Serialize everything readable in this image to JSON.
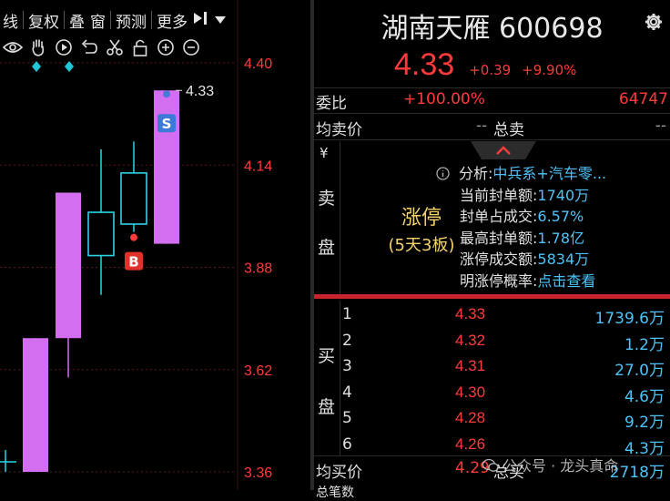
{
  "toolbar": {
    "items": [
      "线",
      "复权",
      "叠",
      "窗",
      "预测",
      "更多"
    ],
    "end_icon": "skip-to-end-icon",
    "dropdown_icon": "caret-down-icon"
  },
  "tools": [
    "eye-icon",
    "hand-icon",
    "replay-icon",
    "undo-icon",
    "scissors-icon",
    "lock-icon",
    "zoom-in-icon",
    "zoom-out-icon"
  ],
  "chart_data": {
    "type": "candlestick",
    "y_ticks": [
      "4.40",
      "4.14",
      "3.88",
      "3.62",
      "3.36"
    ],
    "ylim": [
      3.36,
      4.4
    ],
    "last_label": "4.33",
    "buy_marker": "B",
    "sell_marker": "S",
    "candles": [
      {
        "open": 3.36,
        "close": 3.7,
        "high": 3.7,
        "low": 3.36,
        "style": "limit-up"
      },
      {
        "open": 3.7,
        "close": 4.07,
        "high": 4.07,
        "low": 3.6,
        "style": "limit-up"
      },
      {
        "open": 3.91,
        "close": 4.02,
        "high": 4.18,
        "low": 3.81,
        "style": "hollow"
      },
      {
        "open": 3.99,
        "close": 4.12,
        "high": 4.2,
        "low": 3.97,
        "style": "hollow"
      },
      {
        "open": 3.94,
        "close": 4.33,
        "high": 4.33,
        "low": 3.94,
        "style": "limit-up"
      }
    ],
    "colors": {
      "limit_up": "#d46ef0",
      "hollow": "#2ad4e6",
      "axis": "#ff3b3b"
    }
  },
  "quote": {
    "name_code": "湖南天雁 600698",
    "price": "4.33",
    "change": "+0.39",
    "change_pct": "+9.90%",
    "wei_bi_label": "委比",
    "wei_bi": "+100.00%",
    "wei_cha": "64747",
    "avg_sell_label": "均卖价",
    "avg_sell": "--",
    "total_sell_label": "总卖",
    "total_sell": "--",
    "sell_side_label": [
      "¥",
      "卖",
      "盘"
    ],
    "limit_up_title": "涨停",
    "limit_up_sub": "(5天3板)",
    "analysis": [
      {
        "k": "分析:",
        "v": "中兵系+汽车零..."
      },
      {
        "k": "当前封单额:",
        "v": "1740万"
      },
      {
        "k": "封单占成交:",
        "v": "6.57%"
      },
      {
        "k": "最高封单额:",
        "v": "1.78亿"
      },
      {
        "k": "涨停成交额:",
        "v": "5834万"
      },
      {
        "k": "明涨停概率:",
        "v": "点击查看"
      }
    ],
    "buy_side_label": [
      "买",
      "盘"
    ],
    "bids": [
      {
        "level": "1",
        "price": "4.33",
        "vol": "1739.6万"
      },
      {
        "level": "2",
        "price": "4.32",
        "vol": "1.2万"
      },
      {
        "level": "3",
        "price": "4.31",
        "vol": "27.0万"
      },
      {
        "level": "4",
        "price": "4.30",
        "vol": "4.6万"
      },
      {
        "level": "5",
        "price": "4.28",
        "vol": "9.2万"
      },
      {
        "level": "6",
        "price": "4.26",
        "vol": "4.3万"
      }
    ],
    "avg_buy_label": "均买价",
    "avg_buy": "4.29",
    "total_buy_label": "总买",
    "total_buy": "2718万",
    "bottom_cut": "总笔数"
  },
  "watermark": "公众号 · 龙头真命"
}
